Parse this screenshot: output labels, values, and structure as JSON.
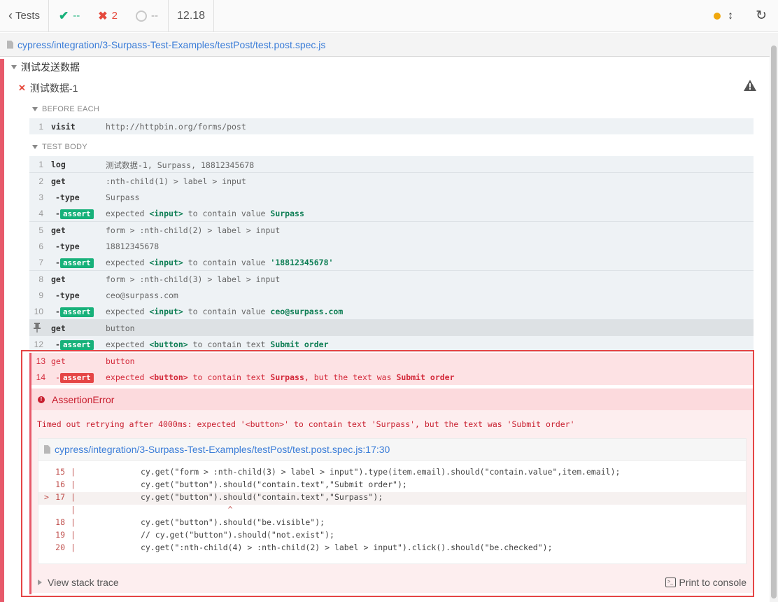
{
  "topbar": {
    "tests_label": "Tests",
    "passed": "--",
    "failed": "2",
    "pending": "--",
    "duration": "12.18"
  },
  "spec_path": "cypress/integration/3-Surpass-Test-Examples/testPost/test.post.spec.js",
  "suite_title": "测试发送数据",
  "test_title": "测试数据-1",
  "before_each_label": "BEFORE EACH",
  "test_body_label": "TEST BODY",
  "before_each_cmds": [
    {
      "num": "1",
      "name": "visit",
      "msg": "http://httpbin.org/forms/post"
    }
  ],
  "cmds": [
    {
      "num": "1",
      "name": "log",
      "msg": "测试数据-1, Surpass, 18812345678"
    },
    {
      "num": "2",
      "name": "get",
      "msg": ":nth-child(1) > label > input"
    },
    {
      "num": "3",
      "name": "-type",
      "msg": "Surpass"
    },
    {
      "num": "4",
      "name": "-",
      "badge": "assert",
      "pre": "expected ",
      "el": "<input>",
      "mid": " to contain value ",
      "val": "Surpass"
    },
    {
      "num": "5",
      "name": "get",
      "msg": "form > :nth-child(2) > label > input"
    },
    {
      "num": "6",
      "name": "-type",
      "msg": "18812345678"
    },
    {
      "num": "7",
      "name": "-",
      "badge": "assert",
      "pre": "expected ",
      "el": "<input>",
      "mid": " to contain value ",
      "val": "'18812345678'"
    },
    {
      "num": "8",
      "name": "get",
      "msg": "form > :nth-child(3) > label > input"
    },
    {
      "num": "9",
      "name": "-type",
      "msg": "ceo@surpass.com"
    },
    {
      "num": "10",
      "name": "-",
      "badge": "assert",
      "pre": "expected ",
      "el": "<input>",
      "mid": " to contain value ",
      "val": "ceo@surpass.com"
    },
    {
      "num": "",
      "name": "get",
      "msg": "button"
    },
    {
      "num": "12",
      "name": "-",
      "badge": "assert",
      "pre": "expected ",
      "el": "<button>",
      "mid": " to contain text ",
      "val": "Submit order"
    }
  ],
  "failed_cmds": [
    {
      "num": "13",
      "name": "get",
      "msg": "button"
    },
    {
      "num": "14",
      "name": "-",
      "badge": "assert",
      "pre": "expected ",
      "el": "<button>",
      "mid": " to contain text ",
      "val": "Surpass",
      "tail": ", but the text was ",
      "val2": "Submit order"
    }
  ],
  "error": {
    "title": "AssertionError",
    "message": "Timed out retrying after 4000ms: expected '<button>' to contain text 'Surpass', but the text was 'Submit order'",
    "file_link": "cypress/integration/3-Surpass-Test-Examples/testPost/test.post.spec.js:17:30",
    "code_lines": [
      {
        "ln": "15",
        "code": "cy.get(\"form > :nth-child(3) > label > input\").type(item.email).should(\"contain.value\",item.email);"
      },
      {
        "ln": "16",
        "code": "cy.get(\"button\").should(\"contain.text\",\"Submit order\");"
      },
      {
        "ln": "17",
        "code": "cy.get(\"button\").should(\"contain.text\",\"Surpass\");",
        "marker": ">"
      },
      {
        "ln": "",
        "code": "                  ^"
      },
      {
        "ln": "18",
        "code": "cy.get(\"button\").should(\"be.visible\");"
      },
      {
        "ln": "19",
        "code": "// cy.get(\"button\").should(\"not.exist\");"
      },
      {
        "ln": "20",
        "code": "cy.get(\":nth-child(4) > :nth-child(2) > label > input\").click().should(\"be.checked\");"
      }
    ],
    "view_stack": "View stack trace",
    "print_console": "Print to console"
  },
  "colors": {
    "pass": "#17b17a",
    "fail": "#e5493c",
    "link": "#3b7dd8",
    "running_dot": "#f0a70c"
  }
}
